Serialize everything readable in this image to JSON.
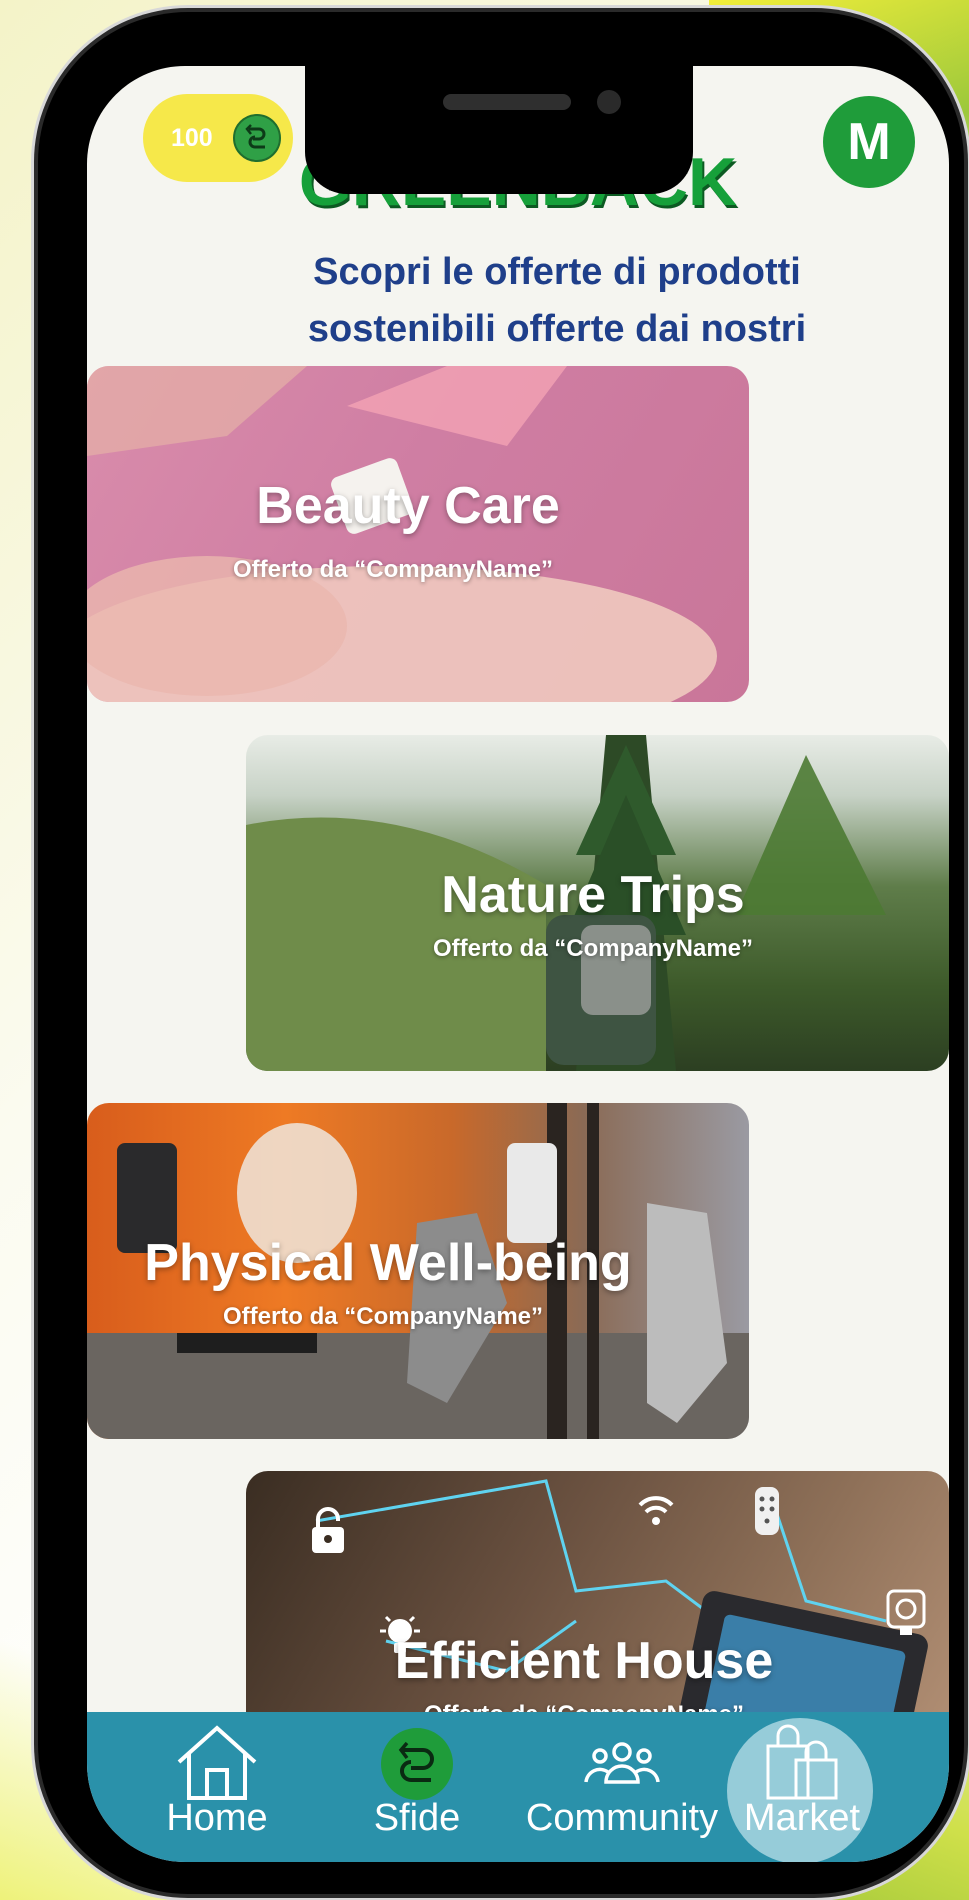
{
  "app": {
    "title": "GREENBACK"
  },
  "header": {
    "points": "100",
    "avatar_initial": "M"
  },
  "intro": {
    "text": "Scopri le offerte  di prodotti sostenibili offerte dai nostri partner!"
  },
  "offers": [
    {
      "title": "Beauty Care",
      "offered_by": "Offerto da “CompanyName”"
    },
    {
      "title": "Nature Trips",
      "offered_by": "Offerto da “CompanyName”"
    },
    {
      "title": "Physical Well-being",
      "offered_by": "Offerto da “CompanyName”"
    },
    {
      "title": "Efficient House",
      "offered_by": "Offerto da “CompanyName”"
    }
  ],
  "nav": {
    "items": [
      {
        "label": "Home",
        "icon": "home-icon"
      },
      {
        "label": "Sfide",
        "icon": "greenback-coin-icon"
      },
      {
        "label": "Community",
        "icon": "community-icon"
      },
      {
        "label": "Market",
        "icon": "shopping-bags-icon",
        "active": true
      }
    ]
  },
  "colors": {
    "brand_green": "#16a03a",
    "subtitle_blue": "#1f3f8a",
    "nav_bar": "#2a91aa",
    "points_pill": "#f6e84a"
  }
}
